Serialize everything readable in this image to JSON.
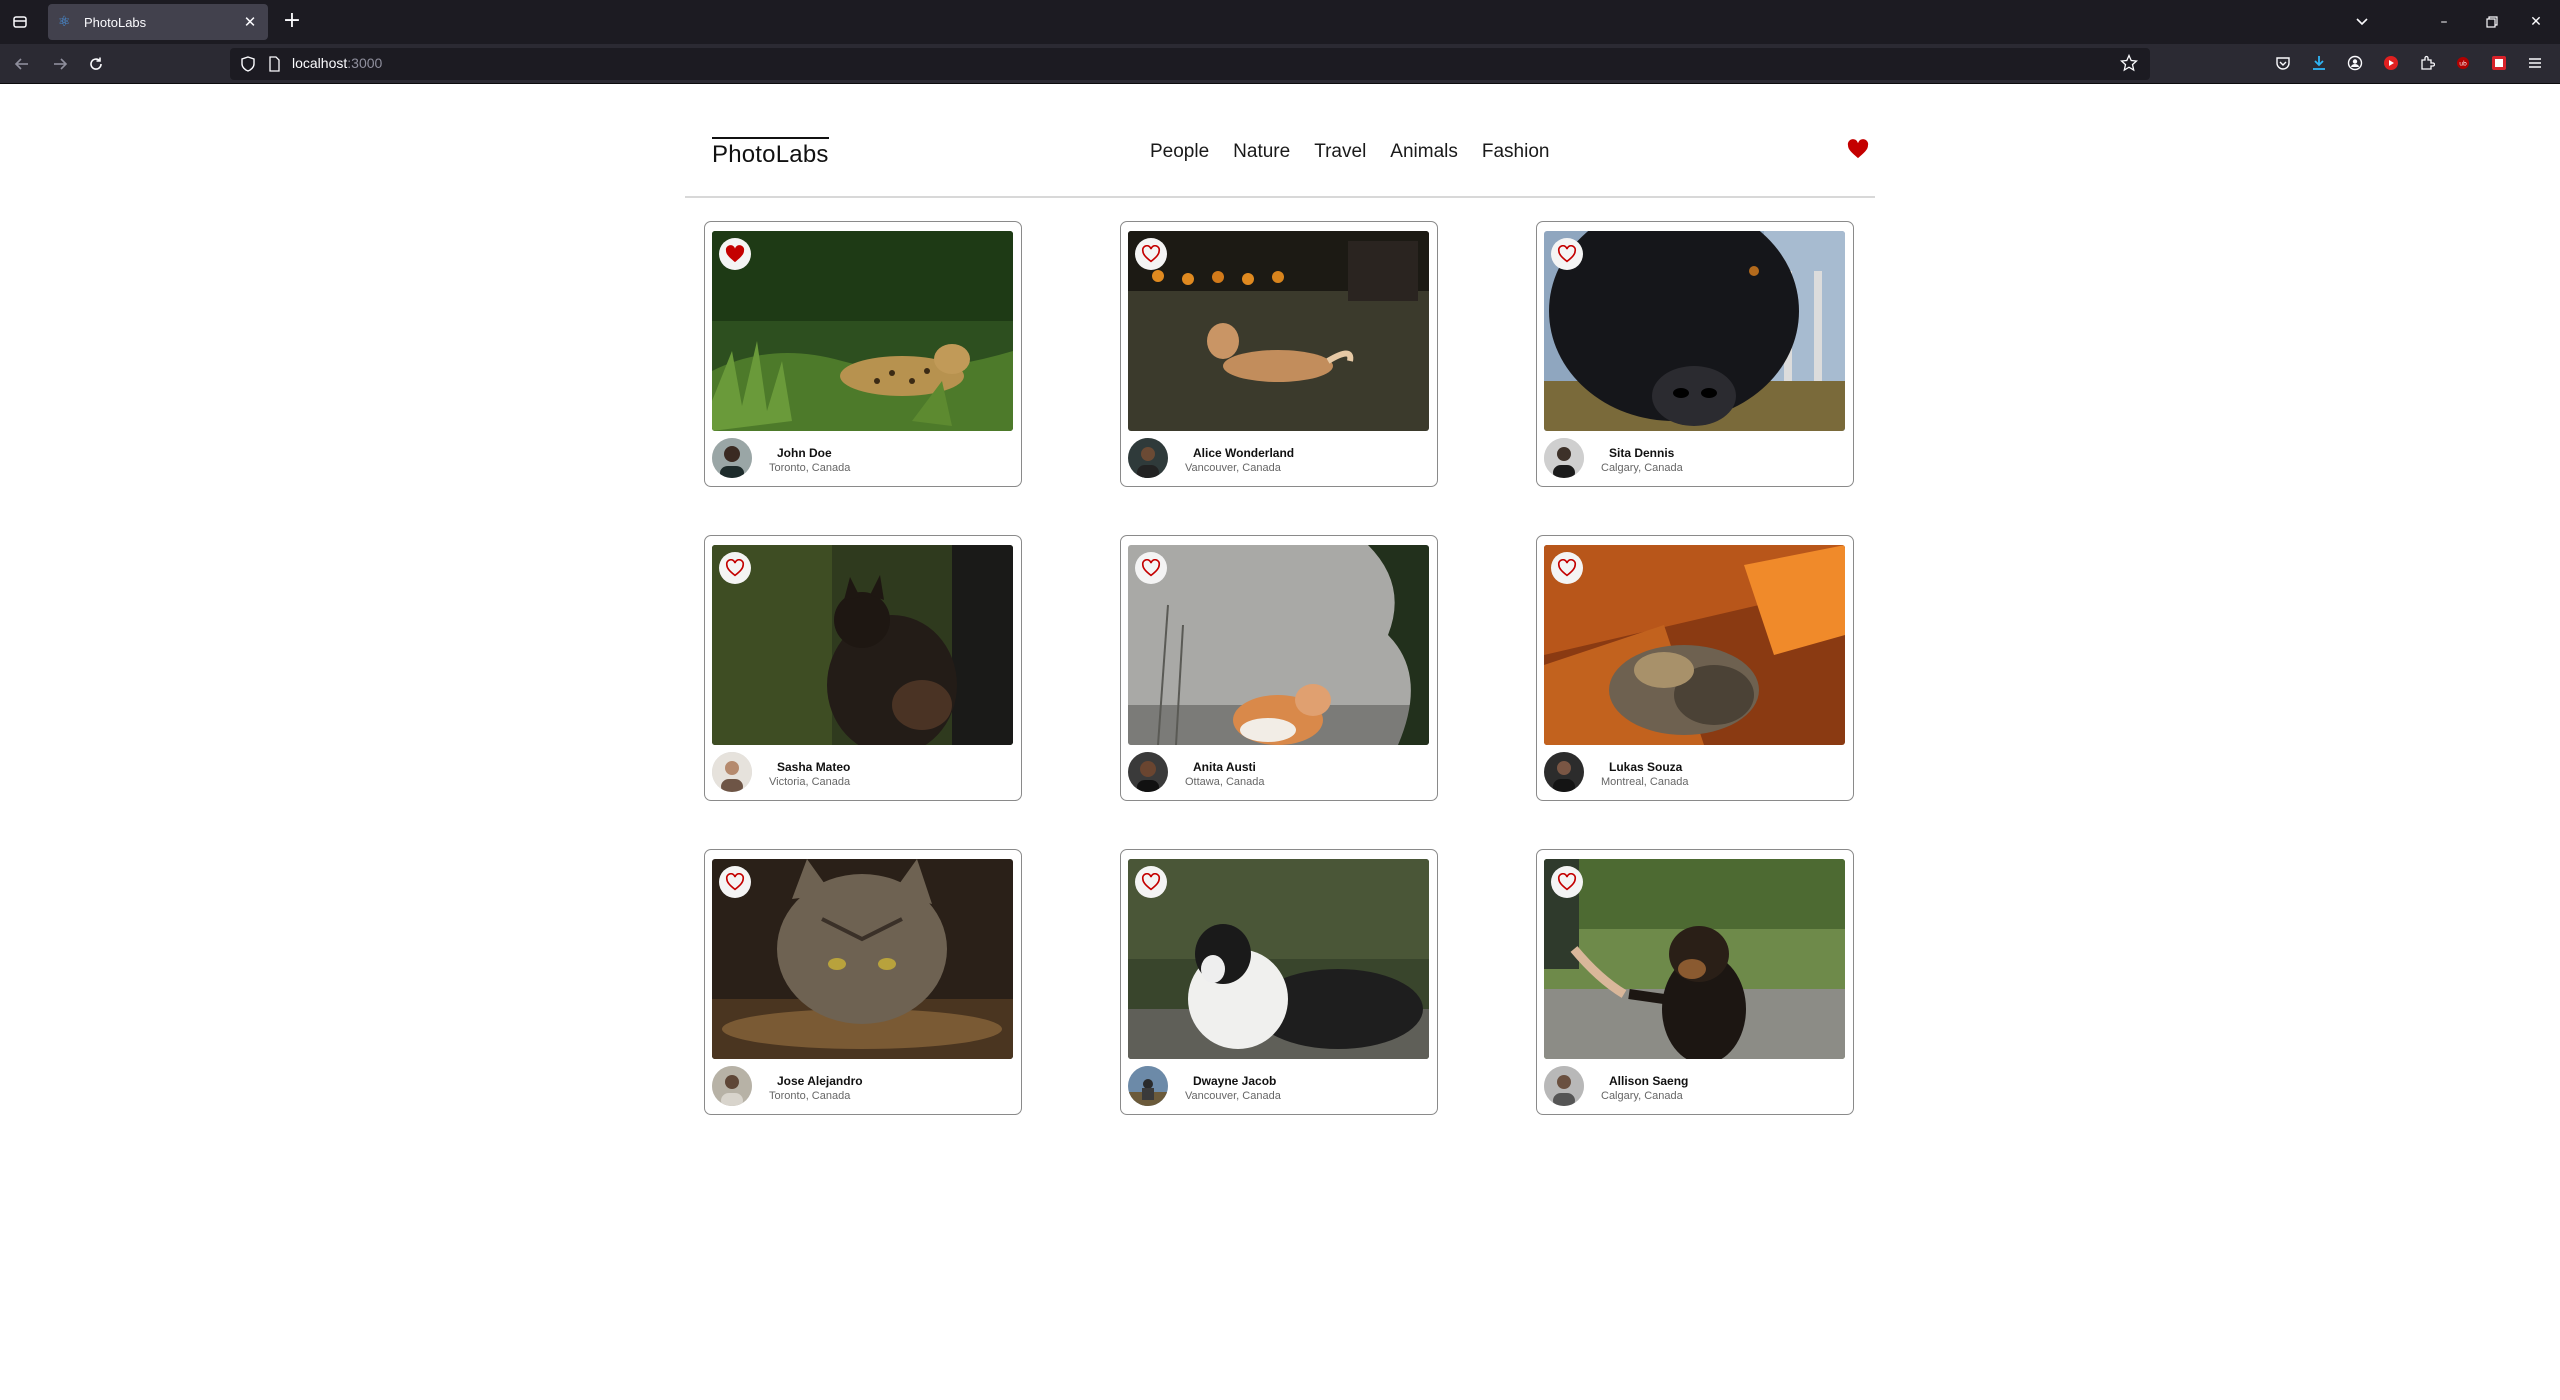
{
  "browser": {
    "tab_title": "PhotoLabs",
    "url_host": "localhost",
    "url_port": ":3000"
  },
  "app": {
    "logo": "PhotoLabs",
    "topics": [
      "People",
      "Nature",
      "Travel",
      "Animals",
      "Fashion"
    ],
    "accent_color": "#c40000"
  },
  "photos": [
    {
      "name": "John Doe",
      "location": "Toronto, Canada",
      "favourited": true
    },
    {
      "name": "Alice Wonderland",
      "location": "Vancouver, Canada",
      "favourited": false
    },
    {
      "name": "Sita Dennis",
      "location": "Calgary, Canada",
      "favourited": false
    },
    {
      "name": "Sasha Mateo",
      "location": "Victoria, Canada",
      "favourited": false
    },
    {
      "name": "Anita Austi",
      "location": "Ottawa, Canada",
      "favourited": false
    },
    {
      "name": "Lukas Souza",
      "location": "Montreal, Canada",
      "favourited": false
    },
    {
      "name": "Jose Alejandro",
      "location": "Toronto, Canada",
      "favourited": false
    },
    {
      "name": "Dwayne Jacob",
      "location": "Vancouver, Canada",
      "favourited": false
    },
    {
      "name": "Allison Saeng",
      "location": "Calgary, Canada",
      "favourited": false
    }
  ]
}
